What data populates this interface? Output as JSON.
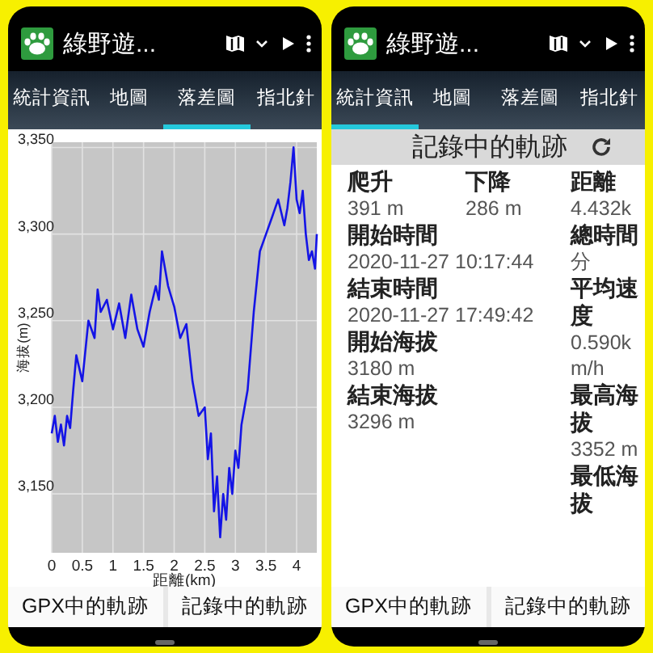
{
  "phones": [
    {
      "app_bar": {
        "title": "綠野遊..."
      },
      "tabs": [
        {
          "label": "統計資訊",
          "selected": false
        },
        {
          "label": "地圖",
          "selected": false
        },
        {
          "label": "落差圖",
          "selected": true
        },
        {
          "label": "指北針",
          "selected": false
        }
      ],
      "content": {
        "kind": "chart",
        "chart_data": {
          "type": "line",
          "xlabel": "距離(km)",
          "ylabel": "海拔(m)",
          "xlim": [
            0,
            4.33
          ],
          "ylim": [
            3116,
            3353
          ],
          "xticks": [
            0,
            0.5,
            1,
            1.5,
            2,
            2.5,
            3,
            3.5,
            4
          ],
          "yticks": [
            {
              "value": 3150,
              "label": "3,150"
            },
            {
              "value": 3200,
              "label": "3,200"
            },
            {
              "value": 3250,
              "label": "3,250"
            },
            {
              "value": 3300,
              "label": "3,300"
            },
            {
              "value": 3350,
              "label": "3,350"
            }
          ],
          "x": [
            0,
            0.05,
            0.1,
            0.15,
            0.2,
            0.25,
            0.3,
            0.35,
            0.4,
            0.5,
            0.6,
            0.7,
            0.75,
            0.8,
            0.9,
            1.0,
            1.1,
            1.2,
            1.3,
            1.4,
            1.5,
            1.6,
            1.7,
            1.75,
            1.8,
            1.9,
            2.0,
            2.1,
            2.2,
            2.3,
            2.4,
            2.5,
            2.55,
            2.6,
            2.65,
            2.7,
            2.75,
            2.8,
            2.85,
            2.9,
            2.95,
            3.0,
            3.05,
            3.1,
            3.2,
            3.3,
            3.4,
            3.5,
            3.6,
            3.7,
            3.8,
            3.85,
            3.9,
            3.95,
            4.0,
            4.05,
            4.1,
            4.15,
            4.2,
            4.25,
            4.3,
            4.33
          ],
          "grid": true,
          "series": [
            {
              "color": "#1414e6",
              "values": [
                3185,
                3195,
                3180,
                3190,
                3178,
                3195,
                3188,
                3210,
                3230,
                3215,
                3250,
                3240,
                3268,
                3255,
                3262,
                3245,
                3260,
                3240,
                3265,
                3245,
                3235,
                3255,
                3270,
                3262,
                3290,
                3270,
                3258,
                3240,
                3248,
                3215,
                3195,
                3200,
                3170,
                3185,
                3140,
                3160,
                3125,
                3150,
                3135,
                3165,
                3150,
                3175,
                3165,
                3190,
                3210,
                3255,
                3290,
                3300,
                3310,
                3320,
                3305,
                3315,
                3330,
                3350,
                3320,
                3312,
                3325,
                3300,
                3285,
                3290,
                3280,
                3300
              ]
            }
          ]
        }
      },
      "bottom_buttons": [
        "GPX中的軌跡",
        "記錄中的軌跡"
      ]
    },
    {
      "app_bar": {
        "title": "綠野遊..."
      },
      "tabs": [
        {
          "label": "統計資訊",
          "selected": true
        },
        {
          "label": "地圖",
          "selected": false
        },
        {
          "label": "落差圖",
          "selected": false
        },
        {
          "label": "指北針",
          "selected": false
        }
      ],
      "content": {
        "kind": "stats",
        "header": "記錄中的軌跡",
        "left": [
          [
            {
              "label": "爬升",
              "value": "391 m"
            },
            {
              "label": "下降",
              "value": "286 m"
            }
          ],
          [
            {
              "label": "開始時間",
              "value": "2020-11-27 10:17:44"
            }
          ],
          [
            {
              "label": "結束時間",
              "value": "2020-11-27 17:49:42"
            }
          ],
          [
            {
              "label": "開始海拔",
              "value": "3180 m"
            }
          ],
          [
            {
              "label": "結束海拔",
              "value": "3296 m"
            }
          ]
        ],
        "right": [
          {
            "label": "距離",
            "value": "4.432k"
          },
          {
            "label": "總時間",
            "value": "分"
          },
          {
            "label": "平均速度",
            "value": "0.590km/h"
          },
          {
            "label": "最高海拔",
            "value": "3352 m"
          },
          {
            "label": "最低海拔"
          }
        ]
      },
      "bottom_buttons": [
        "GPX中的軌跡",
        "記錄中的軌跡"
      ]
    }
  ]
}
